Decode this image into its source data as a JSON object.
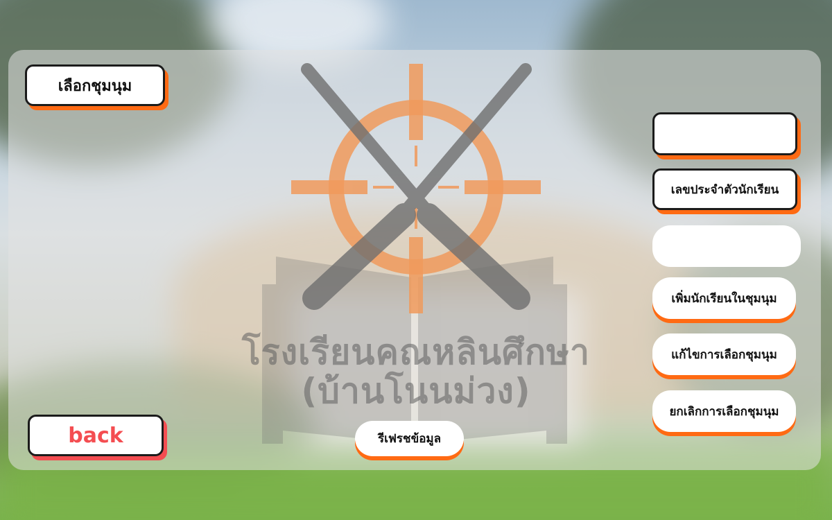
{
  "header": {
    "title_button": "เลือกชุมนุม"
  },
  "emblem": {
    "school_name_line1": "โรงเรียนคณหลินศึกษา",
    "school_name_line2": "(บ้านโนนม่วง)"
  },
  "form": {
    "student_id_input_value": "",
    "student_id_label": "เลขประจำตัวนักเรียน",
    "secondary_input_value": ""
  },
  "actions": {
    "add_student": "เพิ่มนักเรียนในชุมนุม",
    "edit_selection": "แก้ไขการเลือกชุมนุม",
    "cancel_selection": "ยกเลิกการเลือกชุมนุม",
    "refresh": "รีเฟรชข้อมูล",
    "back": "back"
  },
  "colors": {
    "accent_orange": "#ff6a13",
    "back_red": "#f44d51",
    "emblem_orange": "#f09a5c",
    "emblem_gray": "#6f6f6f"
  }
}
